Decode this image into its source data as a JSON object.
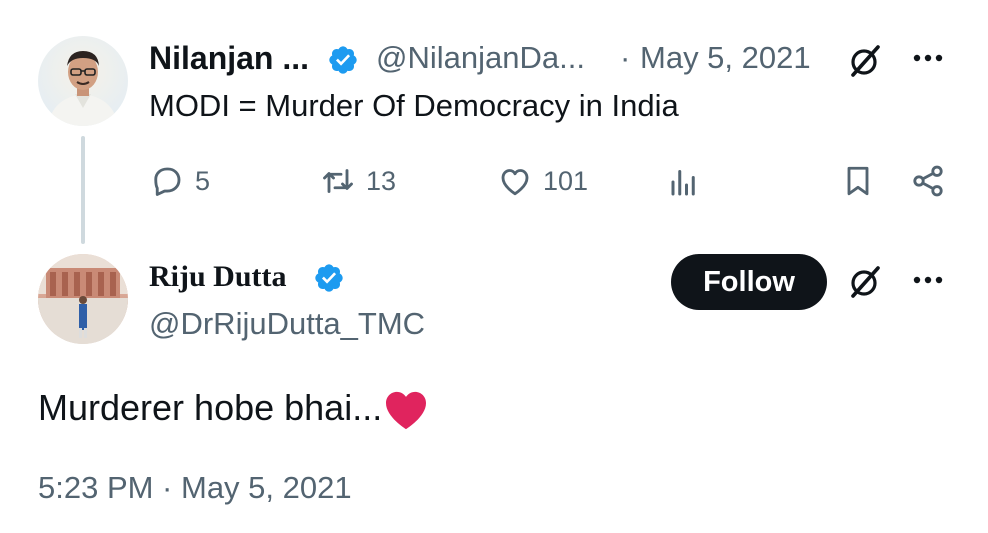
{
  "parent_tweet": {
    "author_name": "Nilanjan ...",
    "handle": "@NilanjanDa...",
    "separator": "·",
    "date": "May 5, 2021",
    "text": "MODI = Murder Of Democracy in India",
    "verified": true,
    "actions": {
      "replies": "5",
      "retweets": "13",
      "likes": "101"
    },
    "icons": [
      "verified-badge-icon",
      "grok-icon",
      "more-icon",
      "reply-icon",
      "retweet-icon",
      "like-icon",
      "views-icon",
      "bookmark-icon",
      "share-icon"
    ]
  },
  "main_tweet": {
    "author_name": "Riju Dutta",
    "handle": "@DrRijuDutta_TMC",
    "verified": true,
    "follow_label": "Follow",
    "text": "Murderer hobe bhai...",
    "emoji": "red-heart",
    "timestamp": "5:23 PM · May 5, 2021"
  },
  "colors": {
    "verified_blue": "#1d9bf0",
    "secondary_text": "#536471",
    "primary_text": "#0f1419",
    "heart_red": "#e0245e"
  }
}
